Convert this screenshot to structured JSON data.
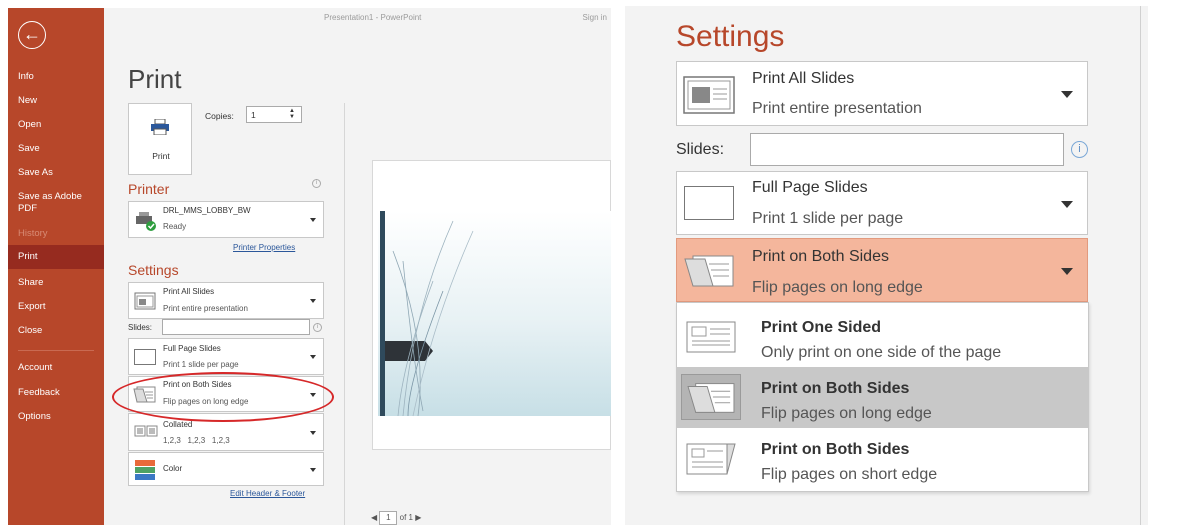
{
  "window": {
    "title": "Presentation1 - PowerPoint",
    "sign_in": "Sign in"
  },
  "nav": {
    "back_icon": "arrow-left-icon",
    "items": [
      {
        "label": "Info"
      },
      {
        "label": "New"
      },
      {
        "label": "Open"
      },
      {
        "label": "Save"
      },
      {
        "label": "Save As"
      },
      {
        "label": "Save as Adobe PDF"
      },
      {
        "label": "History"
      },
      {
        "label": "Print"
      },
      {
        "label": "Share"
      },
      {
        "label": "Export"
      },
      {
        "label": "Close"
      },
      {
        "label": "Account"
      },
      {
        "label": "Feedback"
      },
      {
        "label": "Options"
      }
    ],
    "active": "Print",
    "colors": {
      "background": "#b7472a",
      "active": "#962b1f"
    }
  },
  "print": {
    "heading": "Print",
    "button_label": "Print",
    "copies_label": "Copies:",
    "copies_value": "1"
  },
  "printer": {
    "heading": "Printer",
    "name": "DRL_MMS_LOBBY_BW",
    "status": "Ready",
    "properties_link": "Printer Properties"
  },
  "settings": {
    "heading": "Settings",
    "print_all": {
      "title": "Print All Slides",
      "subtitle": "Print entire presentation"
    },
    "slides_label": "Slides:",
    "slides_value": "",
    "layout": {
      "title": "Full Page Slides",
      "subtitle": "Print 1 slide per page"
    },
    "sides": {
      "title": "Print on Both Sides",
      "subtitle": "Flip pages on long edge"
    },
    "collation": {
      "title": "Collated",
      "subtitle": "1,2,3   1,2,3   1,2,3"
    },
    "color": {
      "title": "Color"
    },
    "edit_header_link": "Edit Header & Footer"
  },
  "pager": {
    "current": "1",
    "of": "of 1"
  },
  "zoom_panel": {
    "heading": "Settings",
    "print_all": {
      "title": "Print All Slides",
      "subtitle": "Print entire presentation"
    },
    "slides_label": "Slides:",
    "layout": {
      "title": "Full Page Slides",
      "subtitle": "Print 1 slide per page"
    },
    "sides": {
      "title": "Print on Both Sides",
      "subtitle": "Flip pages on long edge",
      "highlight_color": "#f4b69c"
    },
    "menu": [
      {
        "title": "Print One Sided",
        "subtitle": "Only print on one side of the page",
        "selected": false
      },
      {
        "title": "Print on Both Sides",
        "subtitle": "Flip pages on long edge",
        "selected": true
      },
      {
        "title": "Print on Both Sides",
        "subtitle": "Flip pages on short edge",
        "selected": false
      }
    ]
  },
  "accent_color": "#b7472a",
  "annotation_color": "#d62829"
}
